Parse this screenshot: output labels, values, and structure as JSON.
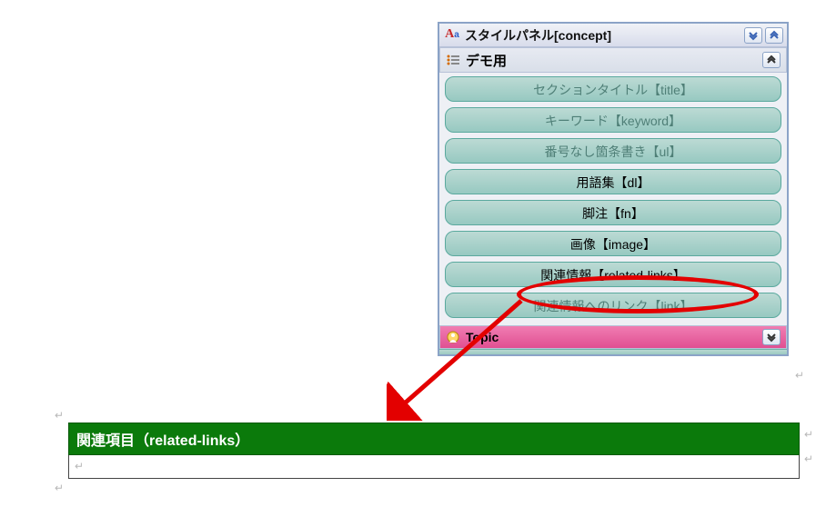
{
  "panel": {
    "title": "スタイルパネル[concept]",
    "section_label": "デモ用",
    "items": [
      {
        "label": "セクションタイトル【title】",
        "enabled": false
      },
      {
        "label": "キーワード【keyword】",
        "enabled": false
      },
      {
        "label": "番号なし箇条書き【ul】",
        "enabled": false
      },
      {
        "label": "用語集【dl】",
        "enabled": true
      },
      {
        "label": "脚注【fn】",
        "enabled": true
      },
      {
        "label": "画像【image】",
        "enabled": true
      },
      {
        "label": "関連情報【related-links】",
        "enabled": true
      },
      {
        "label": "関連情報へのリンク【link】",
        "enabled": false
      }
    ],
    "topic_label": "Topic"
  },
  "result": {
    "header": "関連項目（related-links）"
  }
}
